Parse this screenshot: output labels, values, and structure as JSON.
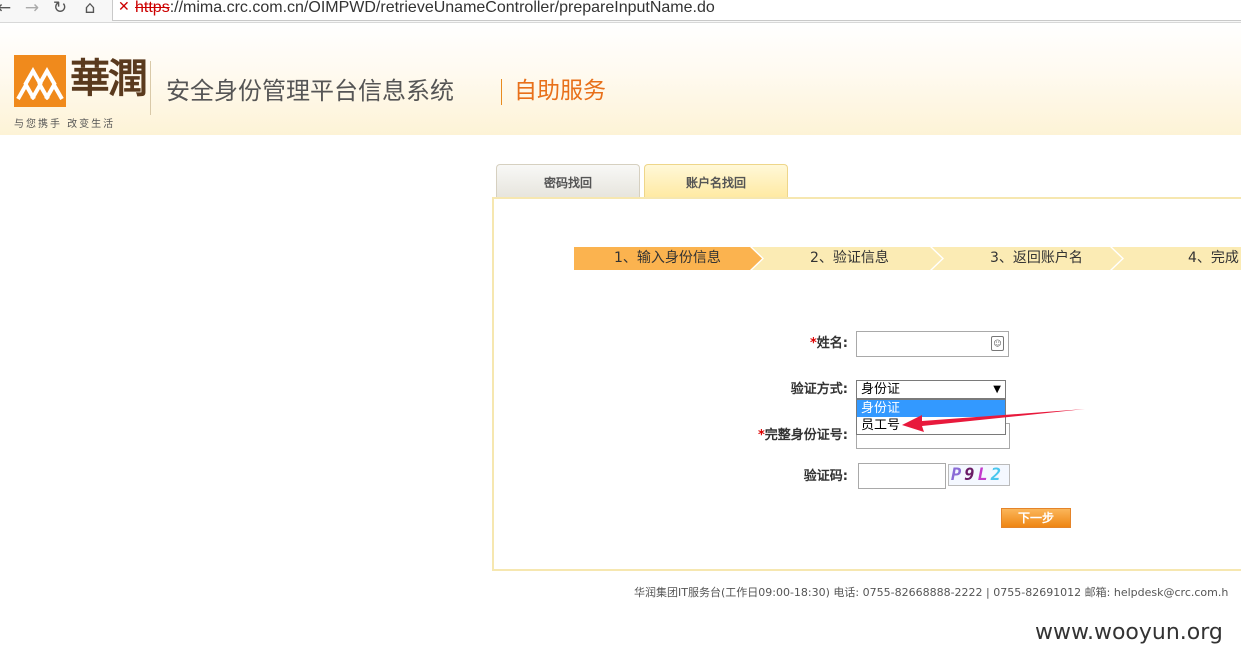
{
  "browser": {
    "url_scheme": "https",
    "url_rest": "://mima.crc.com.cn/OIMPWD/retrieveUnameController/prepareInputName.do",
    "back_glyph": "←",
    "forward_glyph": "→",
    "reload_glyph": "↻",
    "home_glyph": "⌂",
    "warn_glyph": "✕"
  },
  "header": {
    "logo_text": "華潤",
    "slogan": "与您携手 改变生活",
    "title": "安全身份管理平台信息系统",
    "subtitle": "自助服务",
    "brand_color": "#f08a1c"
  },
  "tabs": [
    {
      "label": "密码找回"
    },
    {
      "label": "账户名找回"
    }
  ],
  "steps": [
    {
      "label": "1、输入身份信息"
    },
    {
      "label": "2、验证信息"
    },
    {
      "label": "3、返回账户名"
    },
    {
      "label": "4、完成"
    }
  ],
  "form": {
    "name_label": "姓名:",
    "required_mark": "*",
    "method_label": "验证方式:",
    "method_selected": "身份证",
    "method_options": [
      "身份证",
      "员工号"
    ],
    "id_label": "完整身份证号:",
    "captcha_label": "验证码:",
    "captcha_chars": [
      "P",
      "9",
      "L",
      "2"
    ],
    "next_label": "下一步",
    "contact_icon": "☺"
  },
  "footer": {
    "text": "华润集团IT服务台(工作日09:00-18:30) 电话: 0755-82668888-2222 | 0755-82691012 邮箱: helpdesk@crc.com.h"
  },
  "watermark": "www.wooyun.org"
}
